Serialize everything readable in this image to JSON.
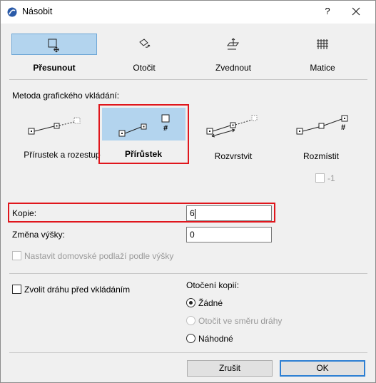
{
  "window": {
    "title": "Násobit",
    "help_label": "?"
  },
  "modes": [
    {
      "label": "Přesunout",
      "icon": "move-icon",
      "active": true
    },
    {
      "label": "Otočit",
      "icon": "rotate-icon",
      "active": false
    },
    {
      "label": "Zvednout",
      "icon": "elevate-icon",
      "active": false
    },
    {
      "label": "Matice",
      "icon": "matrix-icon",
      "active": false
    }
  ],
  "method": {
    "section_label": "Metoda grafického vkládání:",
    "options": [
      {
        "label": "Přírustek a rozestup",
        "selected": false
      },
      {
        "label": "Přírůstek",
        "selected": true
      },
      {
        "label": "Rozvrstvit",
        "selected": false
      },
      {
        "label": "Rozmístit",
        "selected": false
      }
    ],
    "distribute_extra": {
      "label": "-1",
      "checked": false,
      "disabled": true
    },
    "hash_symbol": "#"
  },
  "fields": {
    "copies_label": "Kopie:",
    "copies_value": "6",
    "height_change_label": "Změna výšky:",
    "height_change_value": "0"
  },
  "set_home_story": {
    "label": "Nastavit domovské podlaží podle výšky",
    "checked": false,
    "disabled": true
  },
  "choose_path": {
    "label": "Zvolit dráhu před vkládáním",
    "checked": false
  },
  "rotation": {
    "label": "Otočení kopií:",
    "options": [
      {
        "label": "Žádné",
        "checked": true,
        "disabled": false
      },
      {
        "label": "Otočit ve směru dráhy",
        "checked": false,
        "disabled": true
      },
      {
        "label": "Náhodné",
        "checked": false,
        "disabled": false
      }
    ]
  },
  "buttons": {
    "cancel": "Zrušit",
    "ok": "OK"
  },
  "colors": {
    "highlight": "#b3d4ee",
    "annotation_red": "#e0161c",
    "ok_border": "#2d7fd3"
  }
}
